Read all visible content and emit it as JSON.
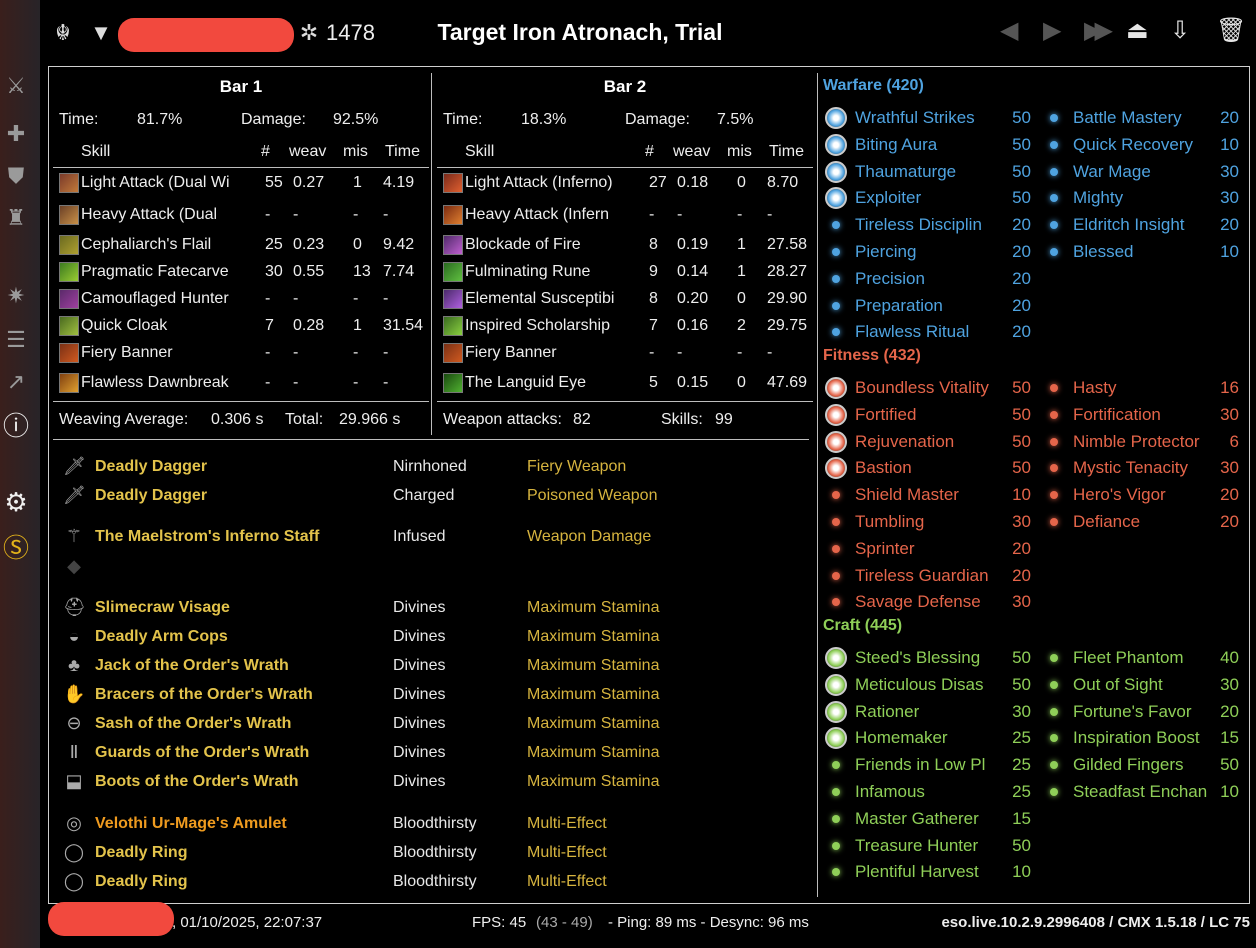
{
  "header": {
    "champion_points": "1478",
    "target": "Target Iron Atronach, Trial"
  },
  "bars": [
    {
      "title": "Bar 1",
      "time_label": "Time:",
      "time": "81.7%",
      "damage_label": "Damage:",
      "damage": "92.5%",
      "columns": [
        "Skill",
        "#",
        "weav",
        "mis",
        "Time"
      ],
      "rows": [
        [
          "Light Attack (Dual Wi",
          "55",
          "0.27",
          "1",
          "4.19"
        ],
        [
          "Heavy Attack (Dual",
          "-",
          "-",
          "-",
          "-"
        ],
        [
          "Cephaliarch's Flail",
          "25",
          "0.23",
          "0",
          "9.42"
        ],
        [
          "Pragmatic Fatecarve",
          "30",
          "0.55",
          "13",
          "7.74"
        ],
        [
          "Camouflaged Hunter",
          "-",
          "-",
          "-",
          "-"
        ],
        [
          "Quick Cloak",
          "7",
          "0.28",
          "1",
          "31.54"
        ],
        [
          "Fiery Banner",
          "-",
          "-",
          "-",
          "-"
        ],
        [
          "Flawless Dawnbreak",
          "-",
          "-",
          "-",
          "-"
        ]
      ],
      "footer_a_label": "Weaving Average:",
      "footer_a": "0.306 s",
      "footer_b_label": "Total:",
      "footer_b": "29.966 s"
    },
    {
      "title": "Bar 2",
      "time_label": "Time:",
      "time": "18.3%",
      "damage_label": "Damage:",
      "damage": "7.5%",
      "columns": [
        "Skill",
        "#",
        "weav",
        "mis",
        "Time"
      ],
      "rows": [
        [
          "Light Attack (Inferno)",
          "27",
          "0.18",
          "0",
          "8.70"
        ],
        [
          "Heavy Attack (Infern",
          "-",
          "-",
          "-",
          "-"
        ],
        [
          "Blockade of Fire",
          "8",
          "0.19",
          "1",
          "27.58"
        ],
        [
          "Fulminating Rune",
          "9",
          "0.14",
          "1",
          "28.27"
        ],
        [
          "Elemental Susceptibi",
          "8",
          "0.20",
          "0",
          "29.90"
        ],
        [
          "Inspired Scholarship",
          "7",
          "0.16",
          "2",
          "29.75"
        ],
        [
          "Fiery Banner",
          "-",
          "-",
          "-",
          "-"
        ],
        [
          "The Languid Eye",
          "5",
          "0.15",
          "0",
          "47.69"
        ]
      ],
      "footer_a_label": "Weapon attacks:",
      "footer_a": "82",
      "footer_b_label": "Skills:",
      "footer_b": "99"
    }
  ],
  "gear": [
    {
      "name": "Deadly Dagger",
      "trait": "Nirnhoned",
      "enchant": "Fiery Weapon",
      "icon": "dagger-icon"
    },
    {
      "name": "Deadly Dagger",
      "trait": "Charged",
      "enchant": "Poisoned Weapon",
      "icon": "dagger-icon"
    },
    {
      "name": "The Maelstrom's Inferno Staff",
      "trait": "Infused",
      "enchant": "Weapon Damage",
      "icon": "staff-icon"
    },
    {
      "name": "Slimecraw Visage",
      "trait": "Divines",
      "enchant": "Maximum Stamina",
      "icon": "helmet-icon"
    },
    {
      "name": "Deadly Arm Cops",
      "trait": "Divines",
      "enchant": "Maximum Stamina",
      "icon": "shoulder-icon"
    },
    {
      "name": "Jack of the Order's Wrath",
      "trait": "Divines",
      "enchant": "Maximum Stamina",
      "icon": "chest-icon"
    },
    {
      "name": "Bracers of the Order's Wrath",
      "trait": "Divines",
      "enchant": "Maximum Stamina",
      "icon": "gloves-icon"
    },
    {
      "name": "Sash of the Order's Wrath",
      "trait": "Divines",
      "enchant": "Maximum Stamina",
      "icon": "belt-icon"
    },
    {
      "name": "Guards of the Order's Wrath",
      "trait": "Divines",
      "enchant": "Maximum Stamina",
      "icon": "legs-icon"
    },
    {
      "name": "Boots of the Order's Wrath",
      "trait": "Divines",
      "enchant": "Maximum Stamina",
      "icon": "boots-icon"
    },
    {
      "name": "Velothi Ur-Mage's Amulet",
      "trait": "Bloodthirsty",
      "enchant": "Multi-Effect",
      "icon": "amulet-icon"
    },
    {
      "name": "Deadly Ring",
      "trait": "Bloodthirsty",
      "enchant": "Multi-Effect",
      "icon": "ring-icon"
    },
    {
      "name": "Deadly Ring",
      "trait": "Bloodthirsty",
      "enchant": "Multi-Effect",
      "icon": "ring-icon"
    }
  ],
  "champion": {
    "warfare": {
      "title": "Warfare (420)",
      "color": "#4fa3e0",
      "left": [
        [
          "Wrathful Strikes",
          "50"
        ],
        [
          "Biting Aura",
          "50"
        ],
        [
          "Thaumaturge",
          "50"
        ],
        [
          "Exploiter",
          "50"
        ],
        [
          "Tireless Disciplin",
          "20"
        ],
        [
          "Piercing",
          "20"
        ],
        [
          "Precision",
          "20"
        ],
        [
          "Preparation",
          "20"
        ],
        [
          "Flawless Ritual",
          "20"
        ]
      ],
      "right": [
        [
          "Battle Mastery",
          "20"
        ],
        [
          "Quick Recovery",
          "10"
        ],
        [
          "War Mage",
          "30"
        ],
        [
          "Mighty",
          "30"
        ],
        [
          "Eldritch Insight",
          "20"
        ],
        [
          "Blessed",
          "10"
        ]
      ]
    },
    "fitness": {
      "title": "Fitness (432)",
      "color": "#e5654a",
      "left": [
        [
          "Boundless Vitality",
          "50"
        ],
        [
          "Fortified",
          "50"
        ],
        [
          "Rejuvenation",
          "50"
        ],
        [
          "Bastion",
          "50"
        ],
        [
          "Shield Master",
          "10"
        ],
        [
          "Tumbling",
          "30"
        ],
        [
          "Sprinter",
          "20"
        ],
        [
          "Tireless Guardian",
          "20"
        ],
        [
          "Savage Defense",
          "30"
        ]
      ],
      "right": [
        [
          "Hasty",
          "16"
        ],
        [
          "Fortification",
          "30"
        ],
        [
          "Nimble Protector",
          "6"
        ],
        [
          "Mystic Tenacity",
          "30"
        ],
        [
          "Hero's Vigor",
          "20"
        ],
        [
          "Defiance",
          "20"
        ]
      ]
    },
    "craft": {
      "title": "Craft (445)",
      "color": "#8fcf58",
      "left": [
        [
          "Steed's Blessing",
          "50"
        ],
        [
          "Meticulous Disas",
          "50"
        ],
        [
          "Rationer",
          "30"
        ],
        [
          "Homemaker",
          "25"
        ],
        [
          "Friends in Low Pl",
          "25"
        ],
        [
          "Infamous",
          "25"
        ],
        [
          "Master Gatherer",
          "15"
        ],
        [
          "Treasure Hunter",
          "50"
        ],
        [
          "Plentiful Harvest",
          "10"
        ]
      ],
      "right": [
        [
          "Fleet Phantom",
          "40"
        ],
        [
          "Out of Sight",
          "30"
        ],
        [
          "Fortune's Favor",
          "20"
        ],
        [
          "Inspiration Boost",
          "15"
        ],
        [
          "Gilded Fingers",
          "50"
        ],
        [
          "Steadfast Enchan",
          "10"
        ]
      ]
    }
  },
  "status": {
    "datetime": ", 01/10/2025, 22:07:37",
    "fps": "FPS: 45",
    "fps_range": "(43 - 49)",
    "ping": "- Ping: 89 ms - Desync: 96 ms",
    "version": "eso.live.10.2.9.2996408 / CMX 1.5.18 / LC 75"
  }
}
